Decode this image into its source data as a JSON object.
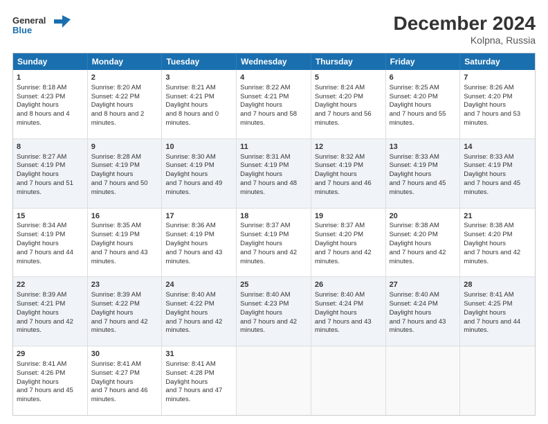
{
  "header": {
    "logo": {
      "line1": "General",
      "line2": "Blue"
    },
    "title": "December 2024",
    "location": "Kolpna, Russia"
  },
  "days": [
    "Sunday",
    "Monday",
    "Tuesday",
    "Wednesday",
    "Thursday",
    "Friday",
    "Saturday"
  ],
  "weeks": [
    [
      {
        "num": "1",
        "rise": "8:18 AM",
        "set": "4:23 PM",
        "daylight": "8 hours and 4 minutes."
      },
      {
        "num": "2",
        "rise": "8:20 AM",
        "set": "4:22 PM",
        "daylight": "8 hours and 2 minutes."
      },
      {
        "num": "3",
        "rise": "8:21 AM",
        "set": "4:21 PM",
        "daylight": "8 hours and 0 minutes."
      },
      {
        "num": "4",
        "rise": "8:22 AM",
        "set": "4:21 PM",
        "daylight": "7 hours and 58 minutes."
      },
      {
        "num": "5",
        "rise": "8:24 AM",
        "set": "4:20 PM",
        "daylight": "7 hours and 56 minutes."
      },
      {
        "num": "6",
        "rise": "8:25 AM",
        "set": "4:20 PM",
        "daylight": "7 hours and 55 minutes."
      },
      {
        "num": "7",
        "rise": "8:26 AM",
        "set": "4:20 PM",
        "daylight": "7 hours and 53 minutes."
      }
    ],
    [
      {
        "num": "8",
        "rise": "8:27 AM",
        "set": "4:19 PM",
        "daylight": "7 hours and 51 minutes."
      },
      {
        "num": "9",
        "rise": "8:28 AM",
        "set": "4:19 PM",
        "daylight": "7 hours and 50 minutes."
      },
      {
        "num": "10",
        "rise": "8:30 AM",
        "set": "4:19 PM",
        "daylight": "7 hours and 49 minutes."
      },
      {
        "num": "11",
        "rise": "8:31 AM",
        "set": "4:19 PM",
        "daylight": "7 hours and 48 minutes."
      },
      {
        "num": "12",
        "rise": "8:32 AM",
        "set": "4:19 PM",
        "daylight": "7 hours and 46 minutes."
      },
      {
        "num": "13",
        "rise": "8:33 AM",
        "set": "4:19 PM",
        "daylight": "7 hours and 45 minutes."
      },
      {
        "num": "14",
        "rise": "8:33 AM",
        "set": "4:19 PM",
        "daylight": "7 hours and 45 minutes."
      }
    ],
    [
      {
        "num": "15",
        "rise": "8:34 AM",
        "set": "4:19 PM",
        "daylight": "7 hours and 44 minutes."
      },
      {
        "num": "16",
        "rise": "8:35 AM",
        "set": "4:19 PM",
        "daylight": "7 hours and 43 minutes."
      },
      {
        "num": "17",
        "rise": "8:36 AM",
        "set": "4:19 PM",
        "daylight": "7 hours and 43 minutes."
      },
      {
        "num": "18",
        "rise": "8:37 AM",
        "set": "4:19 PM",
        "daylight": "7 hours and 42 minutes."
      },
      {
        "num": "19",
        "rise": "8:37 AM",
        "set": "4:20 PM",
        "daylight": "7 hours and 42 minutes."
      },
      {
        "num": "20",
        "rise": "8:38 AM",
        "set": "4:20 PM",
        "daylight": "7 hours and 42 minutes."
      },
      {
        "num": "21",
        "rise": "8:38 AM",
        "set": "4:20 PM",
        "daylight": "7 hours and 42 minutes."
      }
    ],
    [
      {
        "num": "22",
        "rise": "8:39 AM",
        "set": "4:21 PM",
        "daylight": "7 hours and 42 minutes."
      },
      {
        "num": "23",
        "rise": "8:39 AM",
        "set": "4:22 PM",
        "daylight": "7 hours and 42 minutes."
      },
      {
        "num": "24",
        "rise": "8:40 AM",
        "set": "4:22 PM",
        "daylight": "7 hours and 42 minutes."
      },
      {
        "num": "25",
        "rise": "8:40 AM",
        "set": "4:23 PM",
        "daylight": "7 hours and 42 minutes."
      },
      {
        "num": "26",
        "rise": "8:40 AM",
        "set": "4:24 PM",
        "daylight": "7 hours and 43 minutes."
      },
      {
        "num": "27",
        "rise": "8:40 AM",
        "set": "4:24 PM",
        "daylight": "7 hours and 43 minutes."
      },
      {
        "num": "28",
        "rise": "8:41 AM",
        "set": "4:25 PM",
        "daylight": "7 hours and 44 minutes."
      }
    ],
    [
      {
        "num": "29",
        "rise": "8:41 AM",
        "set": "4:26 PM",
        "daylight": "7 hours and 45 minutes."
      },
      {
        "num": "30",
        "rise": "8:41 AM",
        "set": "4:27 PM",
        "daylight": "7 hours and 46 minutes."
      },
      {
        "num": "31",
        "rise": "8:41 AM",
        "set": "4:28 PM",
        "daylight": "7 hours and 47 minutes."
      },
      null,
      null,
      null,
      null
    ]
  ]
}
